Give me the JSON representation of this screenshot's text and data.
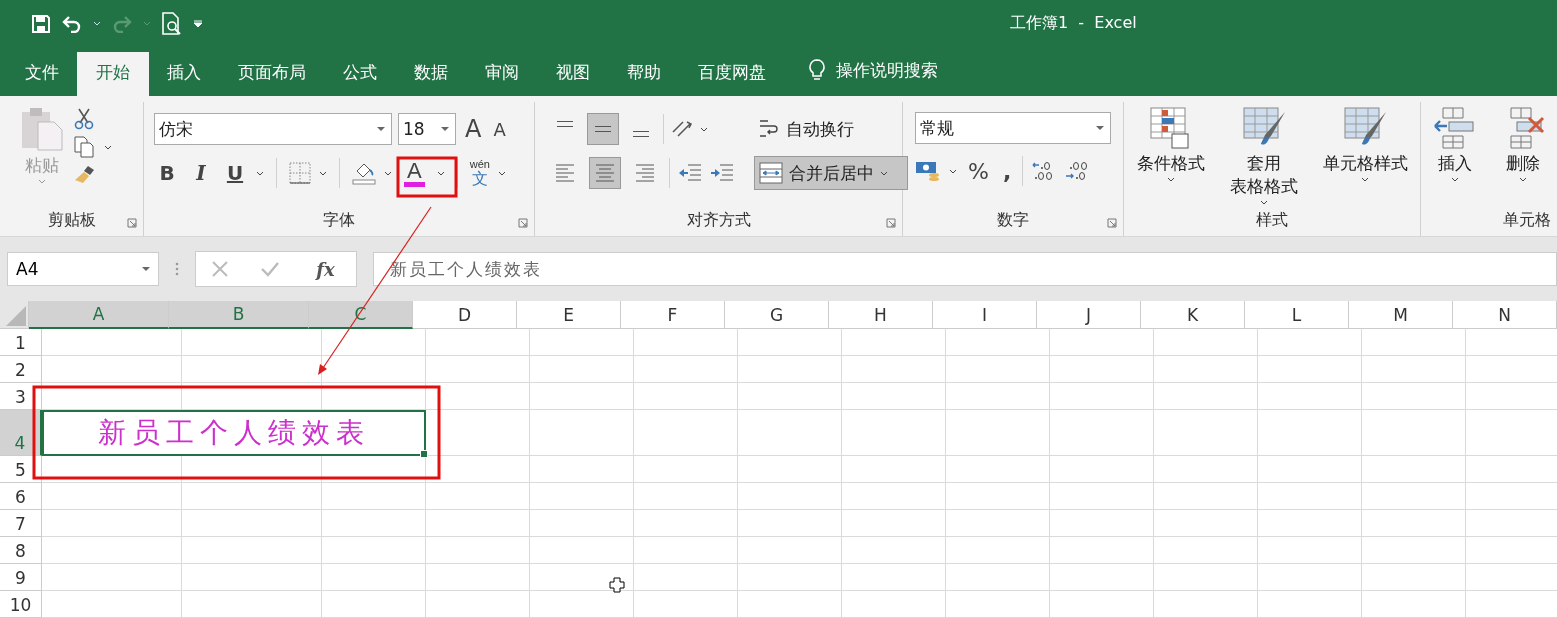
{
  "window": {
    "title": "工作簿1  -  Excel"
  },
  "tabs": [
    {
      "label": "文件",
      "selected": false
    },
    {
      "label": "开始",
      "selected": true
    },
    {
      "label": "插入",
      "selected": false
    },
    {
      "label": "页面布局",
      "selected": false
    },
    {
      "label": "公式",
      "selected": false
    },
    {
      "label": "数据",
      "selected": false
    },
    {
      "label": "审阅",
      "selected": false
    },
    {
      "label": "视图",
      "selected": false
    },
    {
      "label": "帮助",
      "selected": false
    },
    {
      "label": "百度网盘",
      "selected": false
    }
  ],
  "tell_me": "操作说明搜索",
  "clipboard": {
    "paste": "粘贴",
    "group": "剪贴板"
  },
  "font": {
    "name": "仿宋",
    "size": "18",
    "grow": "A",
    "shrink": "A",
    "styles": [
      "B",
      "I",
      "U"
    ],
    "font_color": "A",
    "phonetic_top": "wén",
    "phonetic_bottom": "文",
    "group": "字体"
  },
  "alignment": {
    "vertical": [
      {
        "selected": false
      },
      {
        "selected": true
      },
      {
        "selected": false
      }
    ],
    "horizontal": [
      {
        "selected": false
      },
      {
        "selected": true
      },
      {
        "selected": false
      }
    ],
    "wrap": "自动换行",
    "merge": "合并后居中",
    "merge_selected": true,
    "group": "对齐方式"
  },
  "number": {
    "format": "常规",
    "percent": "%",
    "comma": ",",
    "group": "数字"
  },
  "styles": {
    "buttons": [
      {
        "lines": [
          "条件格式"
        ]
      },
      {
        "lines": [
          "套用",
          "表格格式"
        ]
      },
      {
        "lines": [
          "单元格样式"
        ]
      }
    ],
    "group": "样式"
  },
  "cells": {
    "buttons": [
      "插入",
      "删除"
    ],
    "group": "单元格"
  },
  "formula_bar": {
    "name_box": "A4",
    "fx": "fx",
    "value": "新员工个人绩效表"
  },
  "sheet": {
    "columns": [
      {
        "label": "A",
        "selected": true
      },
      {
        "label": "B",
        "selected": true
      },
      {
        "label": "C",
        "selected": true
      },
      {
        "label": "D",
        "selected": false
      },
      {
        "label": "E",
        "selected": false
      },
      {
        "label": "F",
        "selected": false
      },
      {
        "label": "G",
        "selected": false
      },
      {
        "label": "H",
        "selected": false
      },
      {
        "label": "I",
        "selected": false
      },
      {
        "label": "J",
        "selected": false
      },
      {
        "label": "K",
        "selected": false
      },
      {
        "label": "L",
        "selected": false
      },
      {
        "label": "M",
        "selected": false
      },
      {
        "label": "N",
        "selected": false
      }
    ],
    "rows": [
      {
        "label": "1",
        "selected": false
      },
      {
        "label": "2",
        "selected": false
      },
      {
        "label": "3",
        "selected": false
      },
      {
        "label": "4",
        "selected": true
      },
      {
        "label": "5",
        "selected": false
      },
      {
        "label": "6",
        "selected": false
      },
      {
        "label": "7",
        "selected": false
      },
      {
        "label": "8",
        "selected": false
      },
      {
        "label": "9",
        "selected": false
      },
      {
        "label": "10",
        "selected": false
      }
    ],
    "merged_cell": {
      "text": "新员工个人绩效表"
    }
  }
}
